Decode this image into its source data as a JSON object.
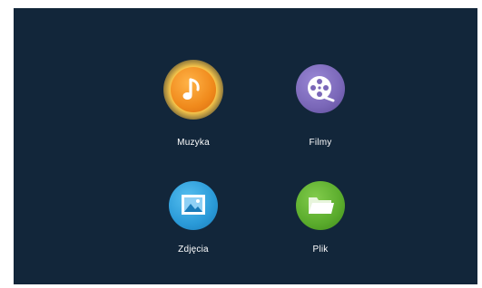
{
  "menu": {
    "items": [
      {
        "label": "Muzyka",
        "icon": "music-note-icon",
        "color": "#f08a1c",
        "selected": true
      },
      {
        "label": "Filmy",
        "icon": "film-reel-icon",
        "color": "#7a67b8",
        "selected": false
      },
      {
        "label": "Zdjęcia",
        "icon": "picture-icon",
        "color": "#2a9ad8",
        "selected": false
      },
      {
        "label": "Plik",
        "icon": "folder-icon",
        "color": "#5aab2c",
        "selected": false
      }
    ]
  },
  "colors": {
    "background": "#12263a",
    "selection_glow": "#e8b23a",
    "label_text": "#ffffff"
  }
}
